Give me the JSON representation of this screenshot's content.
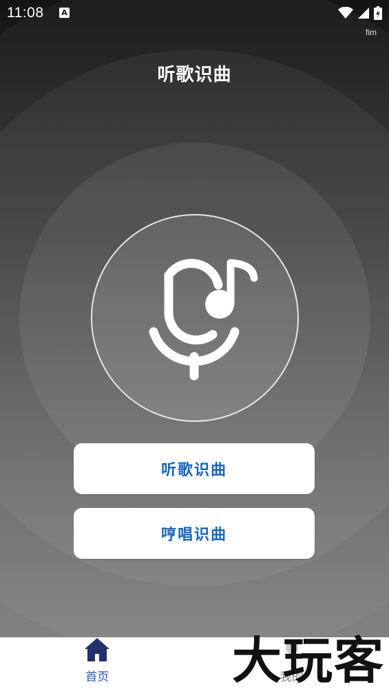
{
  "status_bar": {
    "time": "11:08",
    "notification_badge": "A",
    "ime_label": "fim",
    "icons": [
      "wifi-icon",
      "signal-icon",
      "battery-charging-icon"
    ]
  },
  "header": {
    "title": "听歌识曲"
  },
  "mic": {
    "icon": "mic-music-note-icon"
  },
  "actions": {
    "listen_label": "听歌识曲",
    "hum_label": "哼唱识曲"
  },
  "tabs": [
    {
      "label": "首页",
      "icon": "home-icon",
      "active": true
    },
    {
      "label": "我的",
      "icon": "profile-icon",
      "active": false
    }
  ],
  "watermark": "大玩客",
  "colors": {
    "accent": "#1565c0",
    "tab_active": "#1e56b8",
    "tab_inactive": "#888888"
  }
}
